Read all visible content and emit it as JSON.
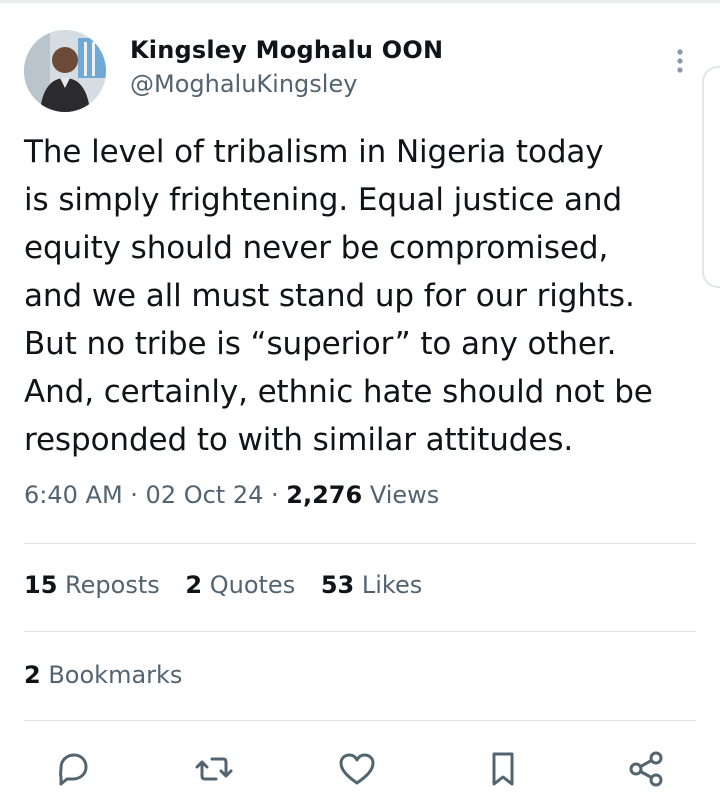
{
  "author": {
    "name": "Kingsley Moghalu OON",
    "handle": "@MoghaluKingsley"
  },
  "tweet": {
    "lines": [
      "The level of tribalism in Nigeria today",
      "is simply frightening. Equal justice and",
      "equity should never be compromised,",
      "and we all must stand up for our rights.",
      "But no tribe is “superior” to any other.",
      "And, certainly, ethnic hate should not be",
      "responded to with similar attitudes."
    ]
  },
  "meta": {
    "time": "6:40 AM",
    "sep1": " · ",
    "date": "02 Oct 24",
    "sep2": " · ",
    "views_count": "2,276",
    "views_label": "Views"
  },
  "stats": {
    "reposts_count": "15",
    "reposts_label": "Reposts",
    "quotes_count": "2",
    "quotes_label": "Quotes",
    "likes_count": "53",
    "likes_label": "Likes",
    "bookmarks_count": "2",
    "bookmarks_label": "Bookmarks"
  },
  "actions": {
    "reply_icon": "reply-icon",
    "repost_icon": "repost-icon",
    "like_icon": "heart-icon",
    "bookmark_icon": "bookmark-icon",
    "share_icon": "share-icon"
  },
  "colors": {
    "text": "#0f1419",
    "secondary": "#536471",
    "divider": "#dfe3e6"
  }
}
